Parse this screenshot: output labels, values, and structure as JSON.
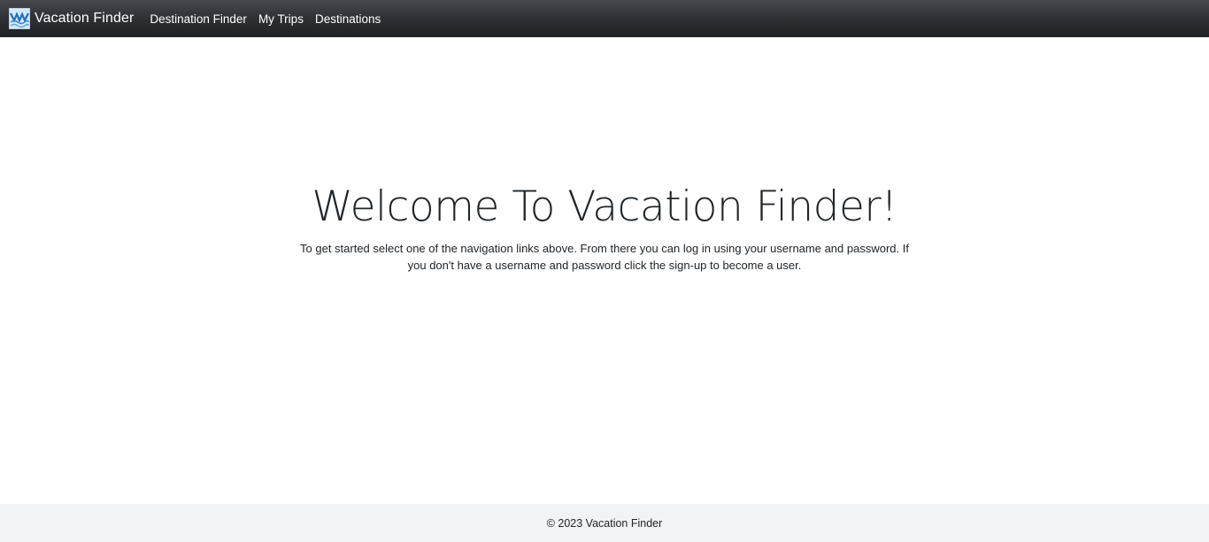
{
  "navbar": {
    "brand": {
      "logo_icon": "vacation-finder-logo",
      "text": "Vacation Finder"
    },
    "links": [
      {
        "label": "Destination Finder"
      },
      {
        "label": "My Trips"
      },
      {
        "label": "Destinations"
      }
    ]
  },
  "main": {
    "title": "Welcome To Vacation Finder!",
    "intro": "To get started select one of the navigation links above. From there you can log in using your username and password. If you don't have a username and password click the sign-up to become a user."
  },
  "footer": {
    "text": "© 2023 Vacation Finder"
  },
  "colors": {
    "navbar_background": "#2f3236",
    "text": "#212529",
    "footer_background": "#f1f3f5"
  }
}
